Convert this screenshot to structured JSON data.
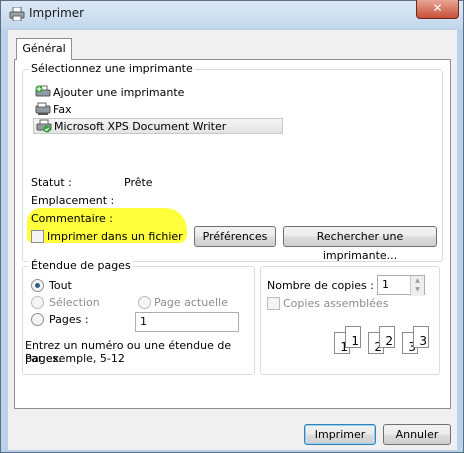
{
  "window": {
    "title": "Imprimer",
    "close_label": "✕"
  },
  "tabs": [
    {
      "label": "Général"
    }
  ],
  "printer_group": {
    "label": "Sélectionnez une imprimante",
    "printers": [
      {
        "name": "Ajouter une imprimante",
        "icon": "add-printer-icon"
      },
      {
        "name": "Fax",
        "icon": "fax-printer-icon"
      },
      {
        "name": "Microsoft XPS Document Writer",
        "icon": "xps-printer-icon",
        "selected": true
      }
    ],
    "status_label": "Statut :",
    "status_value": "Prête",
    "location_label": "Emplacement :",
    "location_value": "",
    "comment_label": "Commentaire :",
    "comment_value": "",
    "print_to_file_label": "Imprimer dans un fichier",
    "print_to_file_checked": false,
    "preferences_button": "Préférences",
    "find_printer_button": "Rechercher une imprimante..."
  },
  "page_range": {
    "label": "Étendue de pages",
    "all_label": "Tout",
    "selection_label": "Sélection",
    "current_page_label": "Page actuelle",
    "pages_label": "Pages :",
    "pages_value": "1",
    "help_line1": "Entrez un numéro ou une étendue de pages.",
    "help_line2": "Par exemple, 5-12",
    "selected": "Tout"
  },
  "copies": {
    "count_label": "Nombre de copies :",
    "count_value": "1",
    "collate_label": "Copies assemblées",
    "collate_checked": false,
    "collate_pages": [
      "1",
      "1",
      "2",
      "2",
      "3",
      "3"
    ]
  },
  "footer": {
    "print_button": "Imprimer",
    "cancel_button": "Annuler"
  },
  "colors": {
    "highlight": "#ffff33",
    "radio_dot": "#2c628b",
    "window_frame": "#b9d1ea"
  }
}
